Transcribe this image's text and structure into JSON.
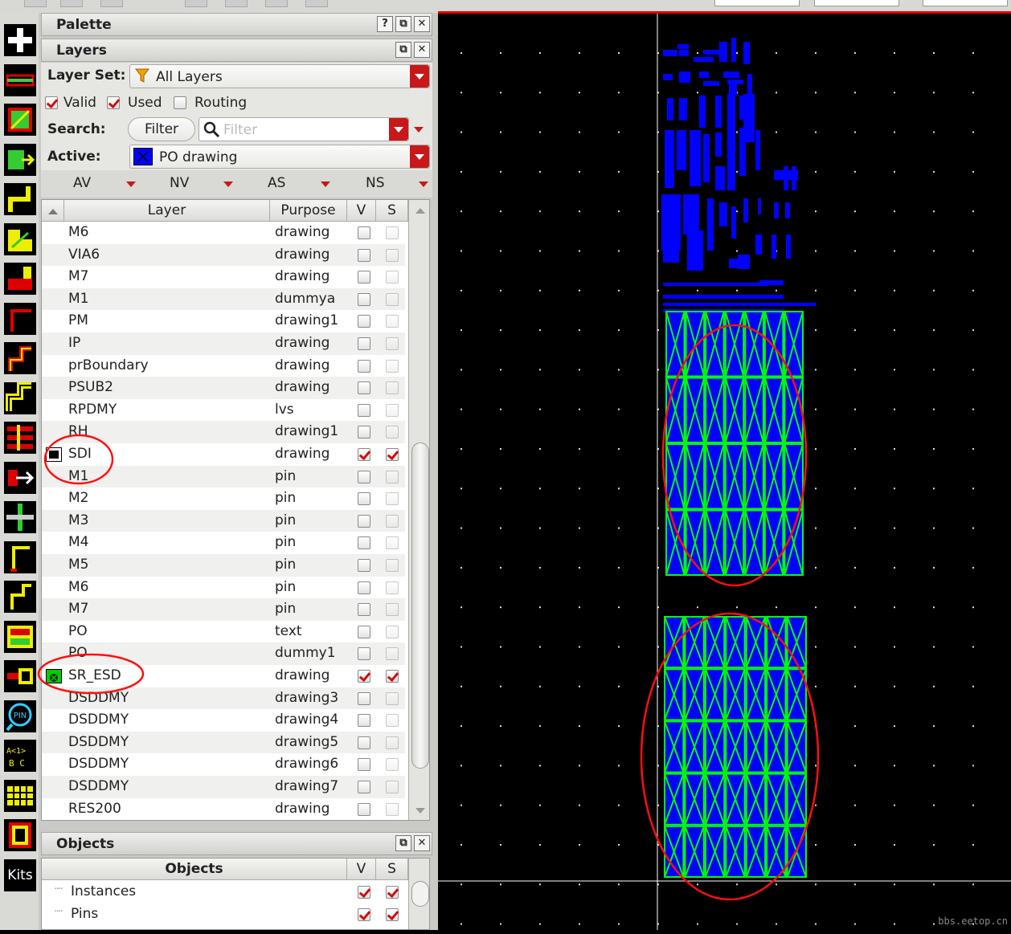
{
  "palette": {
    "title": "Palette",
    "help_btn": "?",
    "float_btn": "⧉",
    "close_btn": "✕"
  },
  "layers": {
    "title": "Layers",
    "layer_set_label": "Layer Set:",
    "layer_set_value": "All Layers",
    "filters": [
      {
        "label": "Valid",
        "checked": true
      },
      {
        "label": "Used",
        "checked": true
      },
      {
        "label": "Routing",
        "checked": false
      }
    ],
    "search_label": "Search:",
    "filter_button": "Filter",
    "search_placeholder": "Filter",
    "active_label": "Active:",
    "active_value": "PO drawing",
    "vis_buttons": [
      "AV",
      "NV",
      "AS",
      "NS"
    ],
    "columns": {
      "layer": "Layer",
      "purpose": "Purpose",
      "v": "V",
      "s": "S"
    },
    "rows": [
      {
        "layer": "M6",
        "purpose": "drawing",
        "v": false,
        "s": false
      },
      {
        "layer": "VIA6",
        "purpose": "drawing",
        "v": false,
        "s": false
      },
      {
        "layer": "M7",
        "purpose": "drawing",
        "v": false,
        "s": false
      },
      {
        "layer": "M1",
        "purpose": "dummya",
        "v": false,
        "s": false
      },
      {
        "layer": "PM",
        "purpose": "drawing1",
        "v": false,
        "s": false
      },
      {
        "layer": "IP",
        "purpose": "drawing",
        "v": false,
        "s": false
      },
      {
        "layer": "prBoundary",
        "purpose": "drawing",
        "v": false,
        "s": false
      },
      {
        "layer": "PSUB2",
        "purpose": "drawing",
        "v": false,
        "s": false
      },
      {
        "layer": "RPDMY",
        "purpose": "lvs",
        "v": false,
        "s": false
      },
      {
        "layer": "RH",
        "purpose": "drawing1",
        "v": false,
        "s": false
      },
      {
        "layer": "SDI",
        "purpose": "drawing",
        "v": true,
        "s": true,
        "swatch": "black"
      },
      {
        "layer": "M1",
        "purpose": "pin",
        "v": false,
        "s": false
      },
      {
        "layer": "M2",
        "purpose": "pin",
        "v": false,
        "s": false
      },
      {
        "layer": "M3",
        "purpose": "pin",
        "v": false,
        "s": false
      },
      {
        "layer": "M4",
        "purpose": "pin",
        "v": false,
        "s": false
      },
      {
        "layer": "M5",
        "purpose": "pin",
        "v": false,
        "s": false
      },
      {
        "layer": "M6",
        "purpose": "pin",
        "v": false,
        "s": false
      },
      {
        "layer": "M7",
        "purpose": "pin",
        "v": false,
        "s": false
      },
      {
        "layer": "PO",
        "purpose": "text",
        "v": false,
        "s": false
      },
      {
        "layer": "PO",
        "purpose": "dummy1",
        "v": false,
        "s": false
      },
      {
        "layer": "SR_ESD",
        "purpose": "drawing",
        "v": true,
        "s": true,
        "swatch": "green"
      },
      {
        "layer": "DSDDMY",
        "purpose": "drawing3",
        "v": false,
        "s": false
      },
      {
        "layer": "DSDDMY",
        "purpose": "drawing4",
        "v": false,
        "s": false
      },
      {
        "layer": "DSDDMY",
        "purpose": "drawing5",
        "v": false,
        "s": false
      },
      {
        "layer": "DSDDMY",
        "purpose": "drawing6",
        "v": false,
        "s": false
      },
      {
        "layer": "DSDDMY",
        "purpose": "drawing7",
        "v": false,
        "s": false
      },
      {
        "layer": "RES200",
        "purpose": "drawing",
        "v": false,
        "s": false
      }
    ]
  },
  "objects": {
    "title": "Objects",
    "columns": {
      "objects": "Objects",
      "v": "V",
      "s": "S"
    },
    "rows": [
      {
        "label": "Instances",
        "v": true,
        "s": true
      },
      {
        "label": "Pins",
        "v": true,
        "s": true
      }
    ]
  },
  "toolbar": {
    "kits_label": "Kits",
    "pin_label": "PIN",
    "abc_label": "A<1>B C"
  },
  "watermark": "bbs.eetop.cn",
  "colors": {
    "accent_red": "#c8181a",
    "layout_blue": "#0000ff",
    "layout_green": "#00ff00",
    "highlight_red": "#ff1010"
  }
}
